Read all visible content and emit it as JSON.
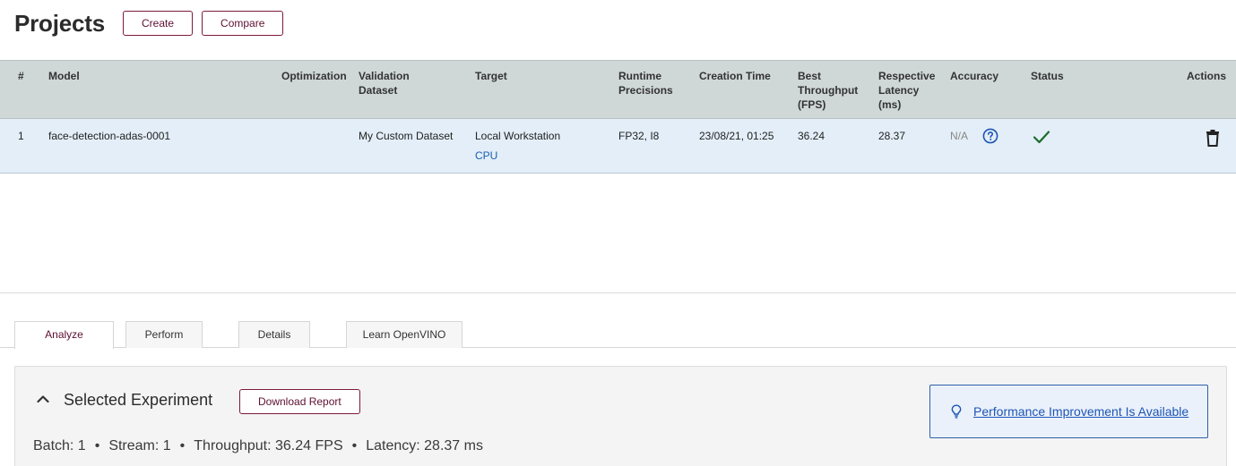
{
  "header": {
    "title": "Projects",
    "create_label": "Create",
    "compare_label": "Compare"
  },
  "table": {
    "columns": {
      "num": "#",
      "model": "Model",
      "optimization": "Optimization",
      "validation_dataset": "Validation Dataset",
      "target": "Target",
      "runtime_precisions": "Runtime Precisions",
      "creation_time": "Creation Time",
      "best_throughput": "Best Throughput (FPS)",
      "respective_latency": "Respective Latency (ms)",
      "accuracy": "Accuracy",
      "status": "Status",
      "actions": "Actions"
    },
    "rows": [
      {
        "num": "1",
        "model": "face-detection-adas-0001",
        "optimization": "",
        "validation_dataset": "My Custom Dataset",
        "target": "Local Workstation",
        "device": "CPU",
        "runtime_precisions": "FP32, I8",
        "creation_time": "23/08/21, 01:25",
        "best_throughput": "36.24",
        "respective_latency": "28.37",
        "accuracy": "N/A",
        "status_icon": "check-icon",
        "accuracy_help_icon": "question-circle-icon",
        "action_icon": "trash-icon"
      }
    ]
  },
  "tabs": [
    {
      "label": "Analyze",
      "active": true
    },
    {
      "label": "Perform",
      "active": false
    },
    {
      "label": "Details",
      "active": false
    },
    {
      "label": "Learn OpenVINO",
      "active": false
    }
  ],
  "panel": {
    "title": "Selected Experiment",
    "download_label": "Download Report",
    "collapse_icon": "chevron-up-icon",
    "summary": {
      "batch": "Batch: 1",
      "stream": "Stream: 1",
      "throughput": "Throughput: 36.24 FPS",
      "latency": "Latency: 28.37 ms",
      "separator": "•"
    },
    "perf_link": "Performance Improvement Is Available",
    "perf_icon": "lightbulb-icon"
  },
  "colors": {
    "accent": "#7b1a3d",
    "table_header_bg": "#cfd7d7",
    "selected_row_bg": "#e3eef8",
    "link_blue": "#1d55b4",
    "success_green": "#1a6b2a"
  }
}
